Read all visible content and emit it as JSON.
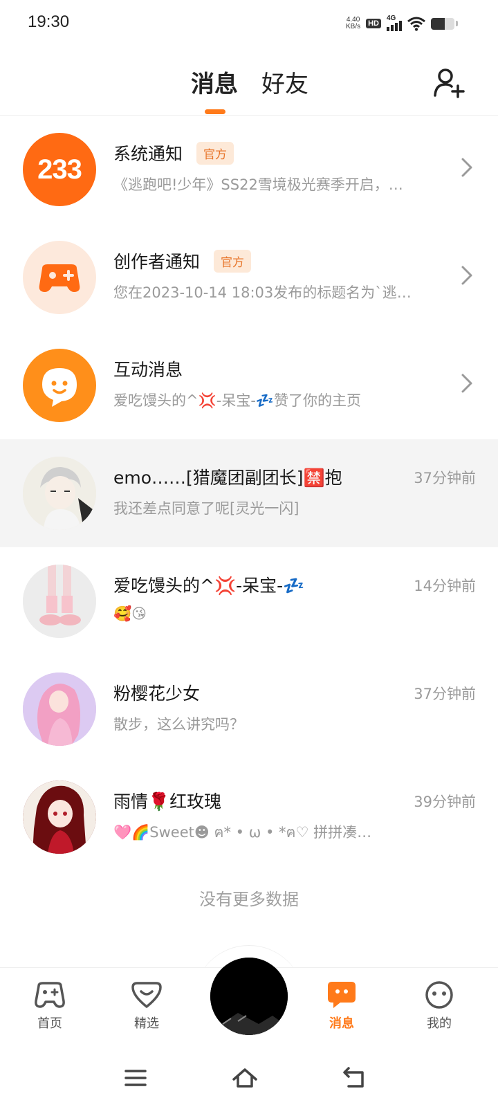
{
  "status_bar": {
    "time": "19:30",
    "net_speed_value": "4.40",
    "net_speed_unit": "KB/s",
    "hd": "HD",
    "network": "4G",
    "battery_level": 0.6
  },
  "header": {
    "tabs": [
      {
        "label": "消息",
        "active": true
      },
      {
        "label": "好友",
        "active": false
      }
    ],
    "add_friend_icon": "add-user-icon"
  },
  "conversations": [
    {
      "avatar": "233-logo",
      "avatar_text": "233",
      "title": "系统通知",
      "badge": "官方",
      "preview": "《逃跑吧!少年》SS22雪境极光赛季开启，…",
      "time": "",
      "chevron": true
    },
    {
      "avatar": "gamepad-icon",
      "title": "创作者通知",
      "badge": "官方",
      "preview": "您在2023-10-14 18:03发布的标题名为`逃…",
      "time": "",
      "chevron": true
    },
    {
      "avatar": "smile-chat-icon",
      "title": "互动消息",
      "badge": "",
      "preview": "爱吃馒头的^💢-呆宝-💤赞了你的主页",
      "time": "",
      "chevron": true
    },
    {
      "avatar": "user-avatar-1",
      "title": "emo……[猎魔团副团长]🈲抱",
      "badge": "",
      "preview": "我还差点同意了呢[灵光一闪]",
      "time": "37分钟前",
      "chevron": false,
      "highlight": true
    },
    {
      "avatar": "user-avatar-2",
      "title": "爱吃馒头的^💢-呆宝-💤",
      "badge": "",
      "preview": "🥰😘",
      "time": "14分钟前",
      "chevron": false
    },
    {
      "avatar": "user-avatar-3",
      "title": "粉樱花少女",
      "badge": "",
      "preview": "散步，这么讲究吗？",
      "time": "37分钟前",
      "chevron": false
    },
    {
      "avatar": "user-avatar-4",
      "title": "雨情🌹红玫瑰",
      "badge": "",
      "preview": "🩷🌈Sweet☻ ฅ* • ω • *ฅ♡ 拼拼凑…",
      "time": "39分钟前",
      "chevron": false
    }
  ],
  "end_of_list": "没有更多数据",
  "bottom_nav": {
    "items": [
      {
        "label": "首页",
        "icon": "gamepad-icon",
        "active": false
      },
      {
        "label": "精选",
        "icon": "heart-chat-icon",
        "active": false
      },
      {
        "label": "消息",
        "icon": "message-icon",
        "active": true
      },
      {
        "label": "我的",
        "icon": "face-icon",
        "active": false
      }
    ],
    "accent": "#ff7a1a"
  },
  "colors": {
    "accent": "#ff7a1a",
    "badge_bg": "#fde9d8",
    "badge_text": "#e8752a",
    "muted_text": "#9a9a9a"
  }
}
